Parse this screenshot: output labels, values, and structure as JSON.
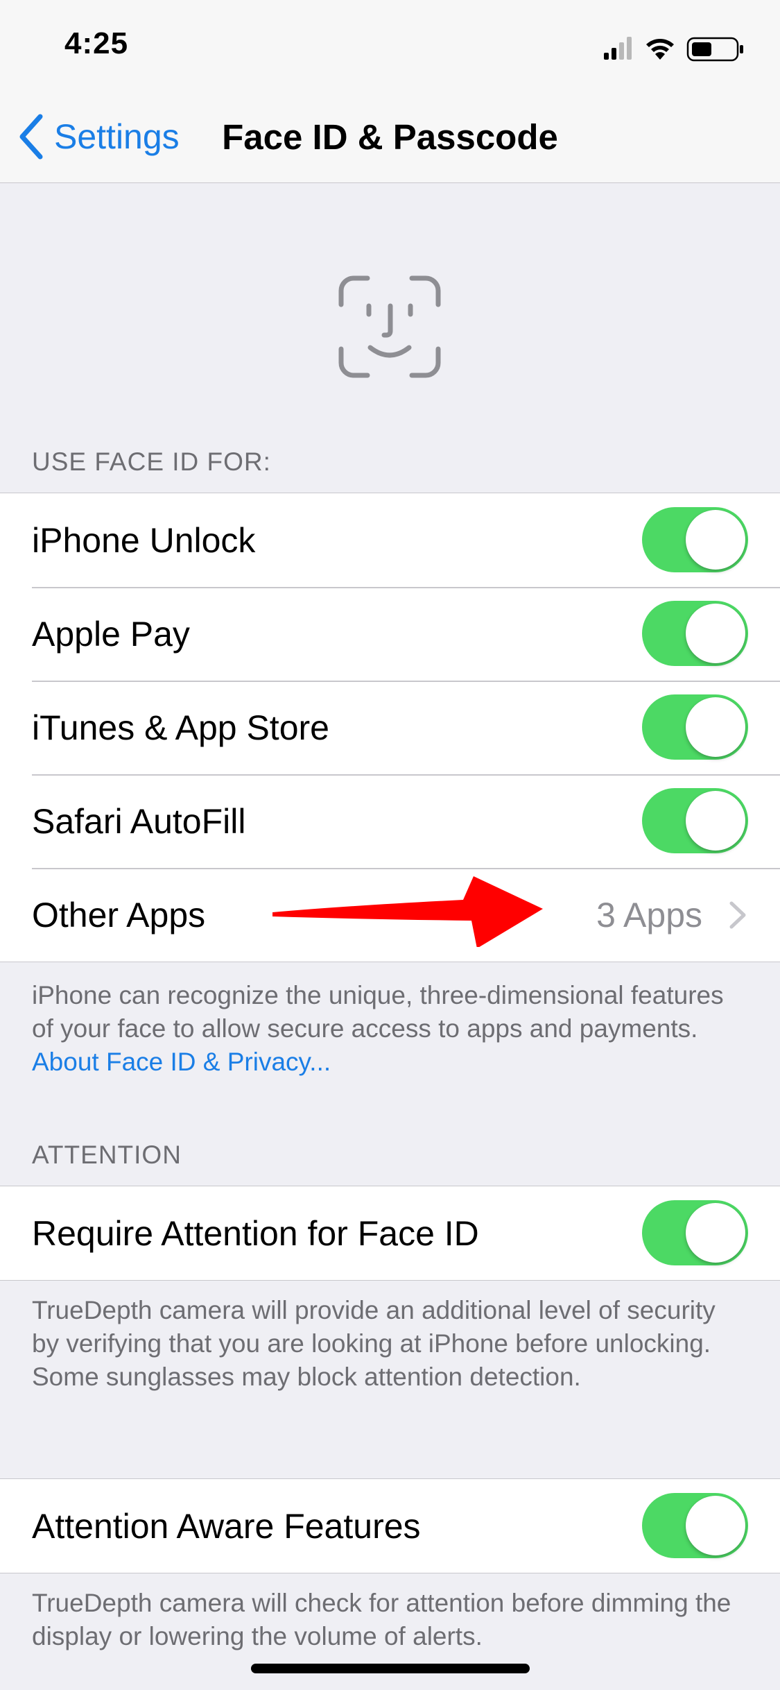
{
  "status_bar": {
    "time": "4:25",
    "icons": [
      "signal-icon",
      "wifi-icon",
      "battery-icon"
    ]
  },
  "nav": {
    "back_label": "Settings",
    "title": "Face ID & Passcode"
  },
  "sections": {
    "use_face_id": {
      "header": "USE FACE ID FOR:",
      "rows": [
        {
          "label": "iPhone Unlock",
          "toggle": true
        },
        {
          "label": "Apple Pay",
          "toggle": true
        },
        {
          "label": "iTunes & App Store",
          "toggle": true
        },
        {
          "label": "Safari AutoFill",
          "toggle": true
        }
      ],
      "other_apps": {
        "label": "Other Apps",
        "value": "3 Apps"
      },
      "footer": "iPhone can recognize the unique, three-dimensional features of your face to allow secure access to apps and payments. ",
      "footer_link": "About Face ID & Privacy..."
    },
    "attention": {
      "header": "ATTENTION",
      "row": {
        "label": "Require Attention for Face ID",
        "toggle": true
      },
      "footer": "TrueDepth camera will provide an additional level of security by verifying that you are looking at iPhone before unlocking. Some sunglasses may block attention detection."
    },
    "attention_aware": {
      "row": {
        "label": "Attention Aware Features",
        "toggle": true
      },
      "footer": "TrueDepth camera will check for attention before dimming the display or lowering the volume of alerts."
    }
  },
  "colors": {
    "accent": "#1a7ee6",
    "toggle_on": "#4cd964",
    "annotation_arrow": "#ff0000"
  }
}
